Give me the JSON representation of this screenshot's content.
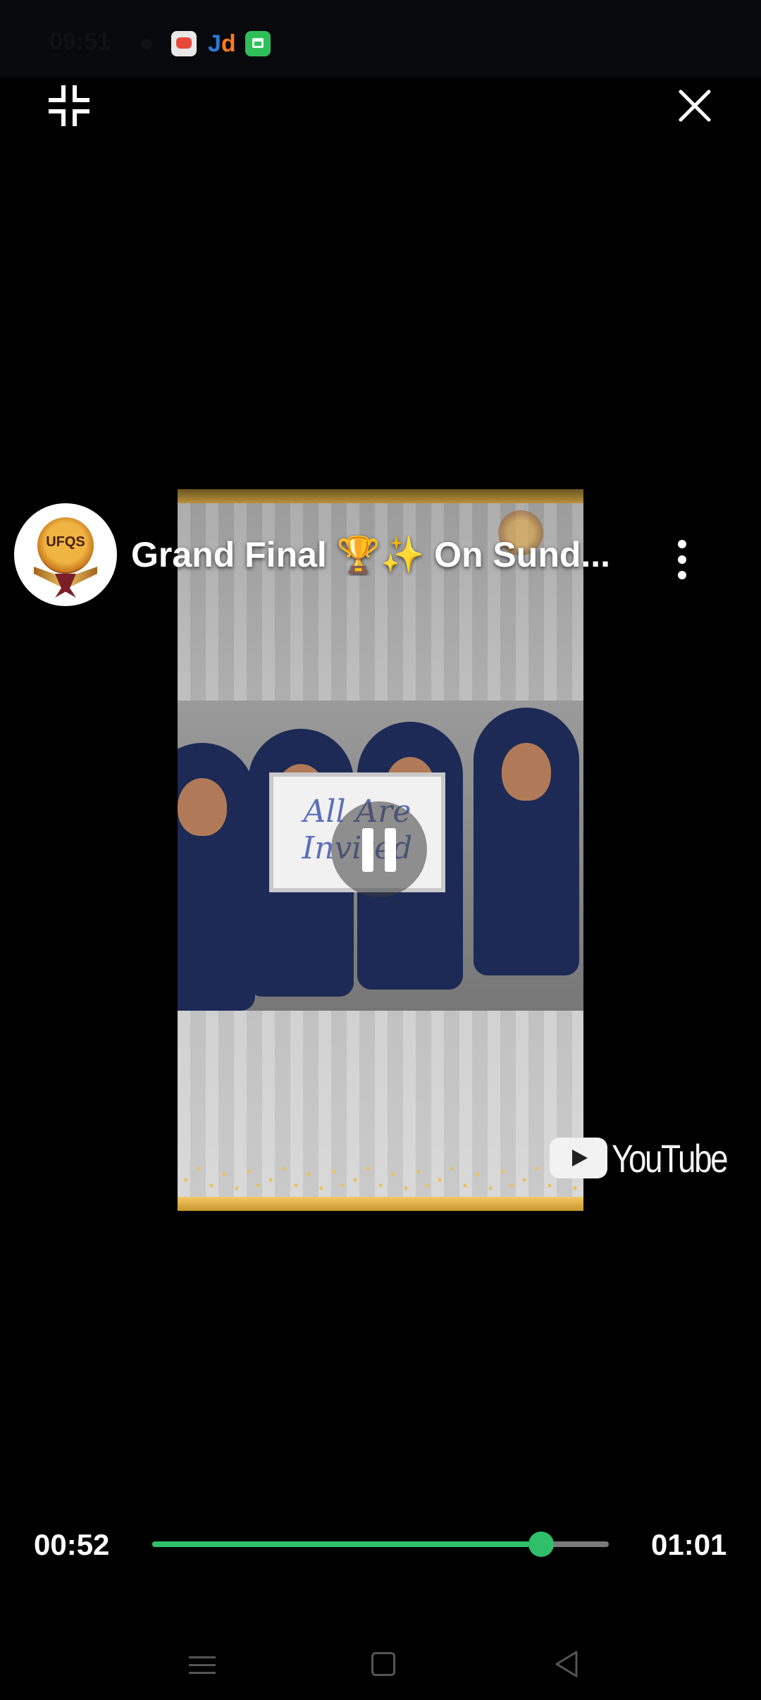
{
  "status_bar": {
    "time": "09:51",
    "right": "",
    "notifications": [
      "game-icon",
      "jd-icon",
      "store-icon"
    ]
  },
  "controls": {
    "minimize_icon": "minimize-icon",
    "close_icon": "close-icon",
    "more_icon": "more-options-icon",
    "pause_icon": "pause-icon"
  },
  "video": {
    "channel_avatar_text": "UFQS",
    "title": "Grand Final 🏆✨ On Sund...",
    "whiteboard_text": "All Are Invited",
    "watermark": "YouTube"
  },
  "player": {
    "current_time": "00:52",
    "total_time": "01:01",
    "progress": 0.852,
    "accent_color": "#2fbf6a"
  },
  "nav_bar": {
    "icons": [
      "menu-icon",
      "home-icon",
      "back-icon"
    ]
  }
}
